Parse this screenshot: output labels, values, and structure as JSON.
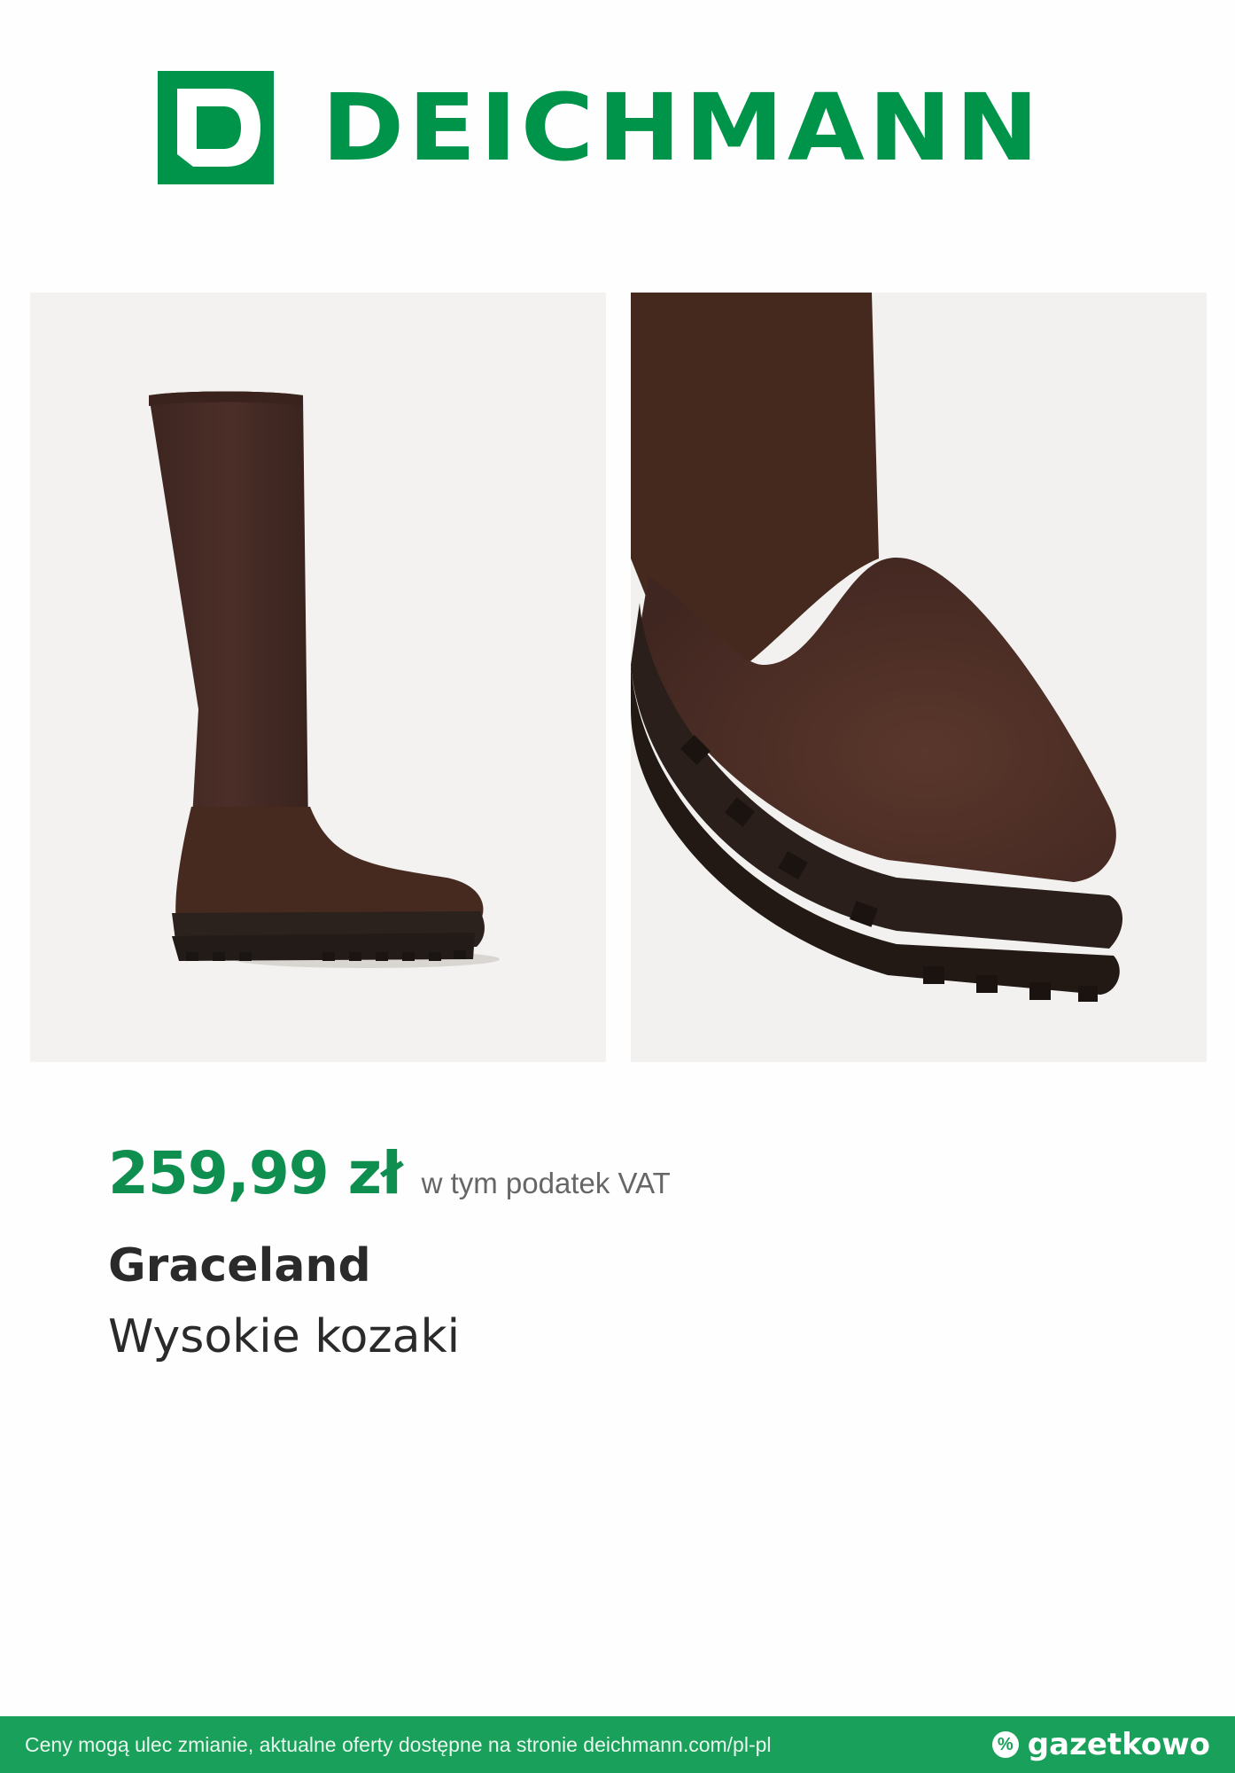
{
  "brand_logo": {
    "letter": "D",
    "word": "DEICHMANN",
    "color": "#00934a"
  },
  "images": {
    "left_alt": "boot-side-view",
    "right_alt": "boot-close-up"
  },
  "product": {
    "price": "259,99 zł",
    "vat_note": "w tym podatek VAT",
    "brand": "Graceland",
    "name": "Wysokie kozaki"
  },
  "footer": {
    "disclaimer": "Ceny mogą ulec zmianie, aktualne oferty dostępne na stronie deichmann.com/pl-pl",
    "gazetkowo_icon": "%",
    "gazetkowo_label": "gazetkowo",
    "background": "#19a05a"
  }
}
